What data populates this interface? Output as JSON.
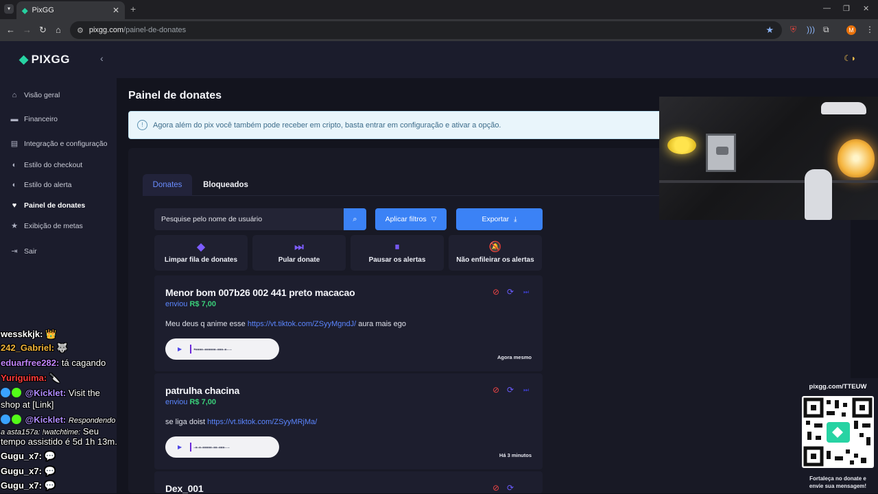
{
  "browser": {
    "tab_title": "PixGG",
    "url_domain": "pixgg.com",
    "url_path": "/painel-de-donates",
    "profile_initial": "M"
  },
  "app": {
    "brand": "PIXGG",
    "sidebar": {
      "items": [
        {
          "label": "Visão geral",
          "icon": "home-icon"
        },
        {
          "label": "Financeiro",
          "icon": "wallet-icon"
        },
        {
          "label": "Integração e configuração",
          "icon": "settings-icon"
        },
        {
          "label": "Estilo do checkout",
          "icon": "palette-icon"
        },
        {
          "label": "Estilo do alerta",
          "icon": "palette-icon"
        },
        {
          "label": "Painel de donates",
          "icon": "hand-heart-icon"
        },
        {
          "label": "Exibição de metas",
          "icon": "star-icon"
        },
        {
          "label": "Sair",
          "icon": "logout-icon"
        }
      ],
      "active_index": 5
    },
    "page_title": "Painel de donates",
    "info_banner": "Agora além do pix você também pode receber em cripto, basta entrar em configuração e ativar a opção.",
    "tabs": [
      "Donates",
      "Bloqueados"
    ],
    "search_placeholder": "Pesquise pelo nome de usuário",
    "filters_label": "Aplicar filtros",
    "export_label": "Exportar",
    "actions": [
      {
        "label": "Limpar fila de donates",
        "icon": "eraser-icon"
      },
      {
        "label": "Pular donate",
        "icon": "skip-icon"
      },
      {
        "label": "Pausar os alertas",
        "icon": "pause-icon"
      },
      {
        "label": "Não enfileirar os alertas",
        "icon": "bell-off-icon"
      }
    ],
    "donations": [
      {
        "name": "Menor bom 007b26 002 441 preto macacao",
        "sent_label": "enviou",
        "amount": "R$ 7,00",
        "message_before": "Meu deus q anime esse ",
        "link": "https://vt.tiktok.com/ZSyyMgndJ/",
        "message_after": " aura mais ego",
        "time": "Agora mesmo"
      },
      {
        "name": "patrulha chacina",
        "sent_label": "enviou",
        "amount": "R$ 7,00",
        "message_before": "se liga doist ",
        "link": "https://vt.tiktok.com/ZSyyMRjMa/",
        "message_after": "",
        "time": "Há 3 minutos"
      },
      {
        "name": "Dex_001"
      }
    ]
  },
  "chat": [
    {
      "user": "wesskkjk:",
      "text": "",
      "color": "#ffffff"
    },
    {
      "user": "242_Gabriel:",
      "text": "",
      "color": "#f0b33a"
    },
    {
      "user": "eduarfree282:",
      "text": "tá cagando",
      "color": "#c084fc"
    },
    {
      "user": "Yuriguima:",
      "text": "",
      "color": "#ff3b3b"
    },
    {
      "mention": "@Kicklet:",
      "text": "Visit the",
      "text2": "shop at [Link]"
    },
    {
      "mention": "@Kicklet:",
      "reply": "Respondendo",
      "reply2": "a asta157a: !watchtime:",
      "text": "Seu",
      "text2": "tempo assistido é 5d 1h 13m."
    },
    {
      "user": "Gugu_x7:",
      "text": "",
      "color": "#ffffff"
    },
    {
      "user": "Gugu_x7:",
      "text": "",
      "color": "#ffffff"
    },
    {
      "user": "Gugu_x7:",
      "text": "",
      "color": "#ffffff"
    }
  ],
  "qr": {
    "url": "pixgg.com/TTEUW",
    "caption_1": "Fortaleça no donate e",
    "caption_2": "envie sua mensagem!"
  },
  "colors": {
    "accent": "#3b82f6",
    "brand": "#27d3a3",
    "amount": "#3ad07a",
    "danger": "#ef4444"
  }
}
